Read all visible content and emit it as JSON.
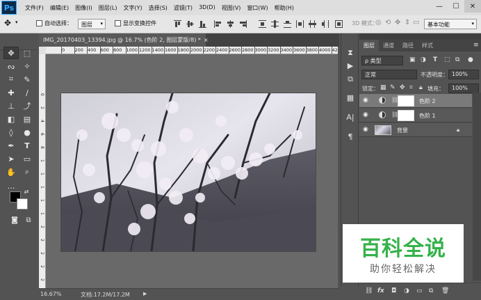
{
  "app": {
    "logo": "Ps"
  },
  "menu": [
    "文件(F)",
    "编辑(E)",
    "图像(I)",
    "图层(L)",
    "文字(Y)",
    "选择(S)",
    "滤镜(T)",
    "3D(D)",
    "视图(V)",
    "窗口(W)",
    "帮助(H)"
  ],
  "window_controls": {
    "minimize": "—",
    "maximize": "☐",
    "close": "✕"
  },
  "options_bar": {
    "auto_select_label": "自动选择：",
    "auto_select_value": "图层",
    "show_transform_label": "显示变换控件",
    "mode_3d_label": "3D 模式：",
    "workspace": "基本功能"
  },
  "document": {
    "tab_title": "IMG_20170403_13394.jpg @ 16.7% (色阶 2, 图层蒙版/8) *",
    "close_glyph": "×",
    "ruler_top": [
      "0",
      "200",
      "400",
      "600",
      "800",
      "1000",
      "1200",
      "1400",
      "1600",
      "1800",
      "2000",
      "2200",
      "2400",
      "2600",
      "2800",
      "3000",
      "3200",
      "3400",
      "3600",
      "3800",
      "4000",
      "4200"
    ],
    "ruler_left": [
      "0",
      "2",
      "4",
      "6",
      "8",
      "1",
      "1",
      "1",
      "1",
      "1",
      "2",
      "2",
      "2",
      "2",
      "2",
      "3"
    ],
    "zoom": "16.67%",
    "file_info": "文档:17.2M/17.2M"
  },
  "layers_panel": {
    "tabs": [
      "图层",
      "通道",
      "路径",
      "样式"
    ],
    "filter_kind": "ρ 类型",
    "blend_mode": "正常",
    "opacity_label": "不透明度：",
    "opacity_value": "100%",
    "lock_label": "锁定：",
    "fill_label": "填充：",
    "fill_value": "100%",
    "layers": [
      {
        "name": "色阶 2",
        "selected": true
      },
      {
        "name": "色阶 1",
        "selected": false
      },
      {
        "name": "背景",
        "selected": false
      }
    ],
    "bottom_fx": "fx"
  },
  "watermark": {
    "title": "百科全说",
    "subtitle": "助你轻松解决"
  },
  "colors": {
    "menubar": "#dedede",
    "panel": "#535353",
    "canvas": "#696969",
    "watermark_green": "#35b24a"
  }
}
